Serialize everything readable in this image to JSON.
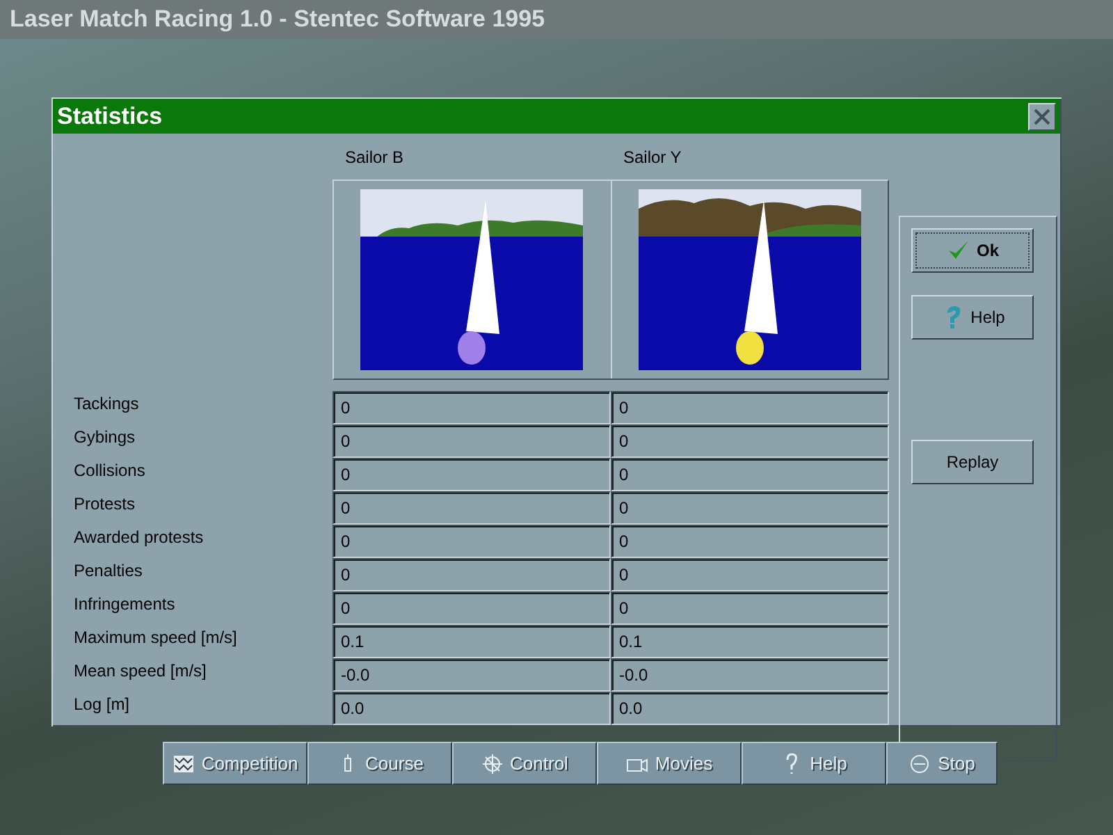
{
  "app_title": "Laser Match Racing 1.0 - Stentec Software 1995",
  "dialog": {
    "title": "Statistics",
    "sailors": [
      {
        "name": "Sailor B",
        "color": "#a080e8"
      },
      {
        "name": "Sailor Y",
        "color": "#f0e040"
      }
    ],
    "rows": [
      {
        "label": "Tackings",
        "values": [
          "0",
          "0"
        ]
      },
      {
        "label": "Gybings",
        "values": [
          "0",
          "0"
        ]
      },
      {
        "label": "Collisions",
        "values": [
          "0",
          "0"
        ]
      },
      {
        "label": "Protests",
        "values": [
          "0",
          "0"
        ]
      },
      {
        "label": "Awarded protests",
        "values": [
          "0",
          "0"
        ]
      },
      {
        "label": "Penalties",
        "values": [
          "0",
          "0"
        ]
      },
      {
        "label": "Infringements",
        "values": [
          "0",
          "0"
        ]
      },
      {
        "label": "Maximum speed [m/s]",
        "values": [
          "0.1",
          "0.1"
        ]
      },
      {
        "label": "Mean speed [m/s]",
        "values": [
          "-0.0",
          "-0.0"
        ]
      },
      {
        "label": "Log [m]",
        "values": [
          "0.0",
          "0.0"
        ]
      }
    ],
    "buttons": [
      {
        "label": "Ok",
        "kind": "ok"
      },
      {
        "label": "Help",
        "kind": "help"
      },
      {
        "label": "Replay",
        "kind": "plain"
      }
    ]
  },
  "toolbar": [
    {
      "label": "Competition",
      "kind": "flags"
    },
    {
      "label": "Course",
      "kind": "buoy"
    },
    {
      "label": "Control",
      "kind": "wheel"
    },
    {
      "label": "Movies",
      "kind": "camera"
    },
    {
      "label": "Help",
      "kind": "help"
    },
    {
      "label": "Stop",
      "kind": "stop"
    }
  ]
}
